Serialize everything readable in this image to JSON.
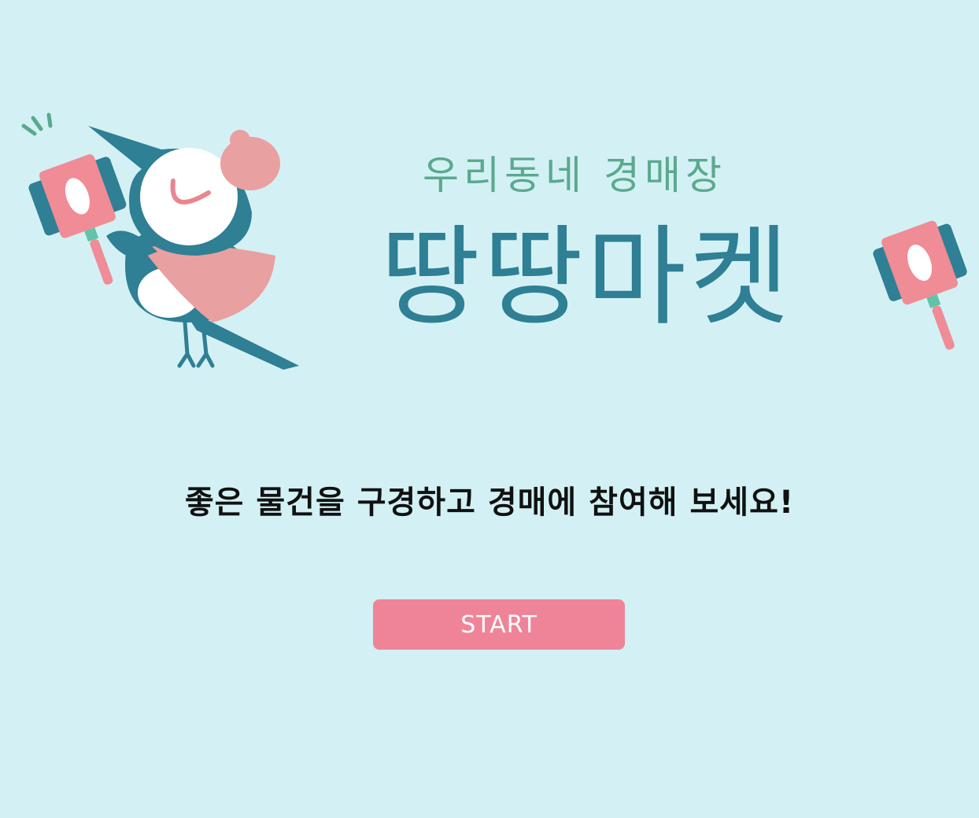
{
  "logo": {
    "subtitle": "우리동네 경매장",
    "title": "땅땅마켓"
  },
  "tagline": "좋은 물건을 구경하고 경매에 참여해 보세요!",
  "start_button": {
    "label": "START"
  },
  "colors": {
    "background": "#d3f1f4",
    "brand_blue": "#2f7f95",
    "brand_green": "#5aa98f",
    "brand_pink": "#ef8499",
    "mascot_pink": "#e9a0a0"
  },
  "icons": [
    "magpie-mascot-icon",
    "auction-gavel-icon"
  ]
}
